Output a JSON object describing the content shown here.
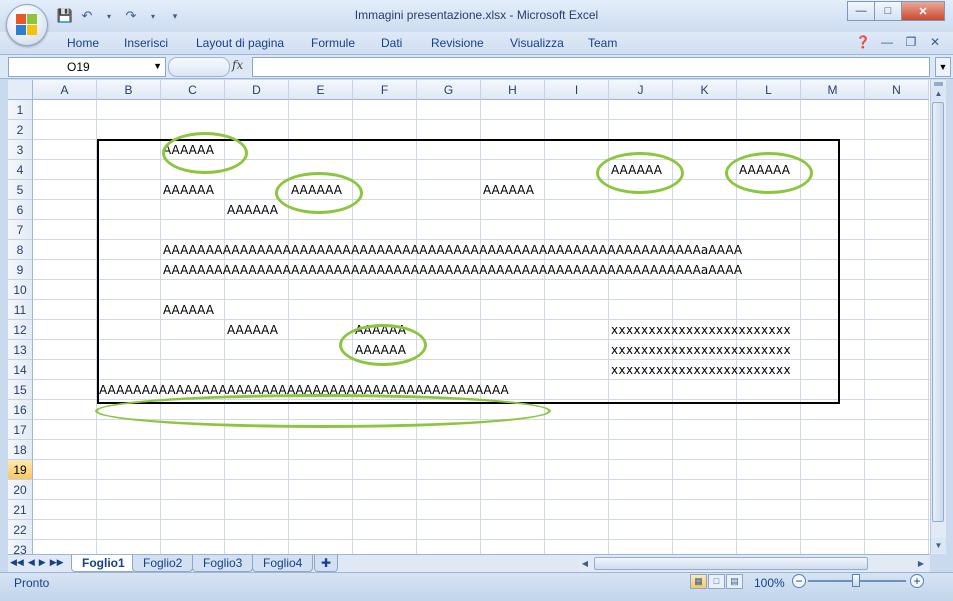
{
  "window": {
    "title": "Immagini presentazione.xlsx - Microsoft Excel"
  },
  "ribbon": {
    "tabs": [
      "Home",
      "Inserisci",
      "Layout di pagina",
      "Formule",
      "Dati",
      "Revisione",
      "Visualizza",
      "Team"
    ]
  },
  "formula_bar": {
    "name_box": "O19",
    "fx_label": "fx",
    "content": ""
  },
  "grid": {
    "columns": [
      "A",
      "B",
      "C",
      "D",
      "E",
      "F",
      "G",
      "H",
      "I",
      "J",
      "K",
      "L",
      "M",
      "N"
    ],
    "rows": [
      "1",
      "2",
      "3",
      "4",
      "5",
      "6",
      "7",
      "8",
      "9",
      "10",
      "11",
      "12",
      "13",
      "14",
      "15",
      "16",
      "17",
      "18",
      "19",
      "20",
      "21",
      "22",
      "23"
    ],
    "selected_row": "19",
    "cells": [
      {
        "ref": "C3",
        "text": "AAAAAA"
      },
      {
        "ref": "J4",
        "text": "AAAAAA"
      },
      {
        "ref": "L4",
        "text": "AAAAAA"
      },
      {
        "ref": "C5",
        "text": "AAAAAA"
      },
      {
        "ref": "E5",
        "text": "AAAAAA"
      },
      {
        "ref": "H5",
        "text": "AAAAAA"
      },
      {
        "ref": "D6",
        "text": "AAAAAA"
      },
      {
        "ref": "C8",
        "text": "AAAAAAAAAAAAAAAAAAAAAAAAAAAAAAAAAAAAAAAAAAAAAAAAAAAAAAAAAAAAAAAaAAAA"
      },
      {
        "ref": "C9",
        "text": "AAAAAAAAAAAAAAAAAAAAAAAAAAAAAAAAAAAAAAAAAAAAAAAAAAAAAAAAAAAAAAAaAAAA"
      },
      {
        "ref": "C11",
        "text": "AAAAAA"
      },
      {
        "ref": "D12",
        "text": "AAAAAA"
      },
      {
        "ref": "F12",
        "text": "AAAAAA"
      },
      {
        "ref": "F13",
        "text": "AAAAAA"
      },
      {
        "ref": "J12",
        "text": "xxxxxxxxxxxxxxxxxxxxxxxx"
      },
      {
        "ref": "J13",
        "text": "xxxxxxxxxxxxxxxxxxxxxxxx"
      },
      {
        "ref": "J14",
        "text": "xxxxxxxxxxxxxxxxxxxxxxxx"
      },
      {
        "ref": "B15",
        "text": "AAAAAAAAAAAAAAAAAAAAAAAAAAAAAAAAAAAAAAAAAAAAAAAA"
      }
    ]
  },
  "sheets": {
    "tabs": [
      "Foglio1",
      "Foglio2",
      "Foglio3",
      "Foglio4"
    ],
    "active": "Foglio1"
  },
  "status": {
    "text": "Pronto",
    "zoom": "100%"
  },
  "colors": {
    "ellipse": "#8cc63f",
    "border": "#000000",
    "selected_row": "#f8c862"
  }
}
